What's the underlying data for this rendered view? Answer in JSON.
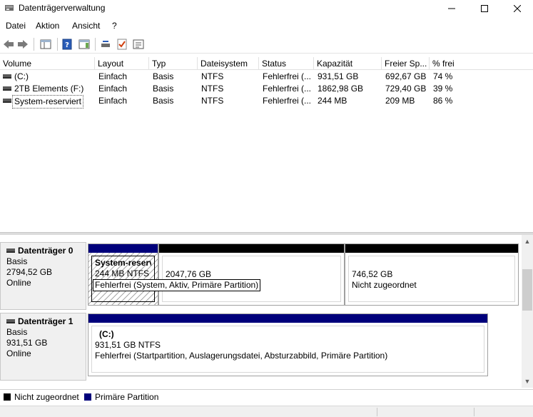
{
  "window": {
    "title": "Datenträgerverwaltung"
  },
  "menu": {
    "items": [
      "Datei",
      "Aktion",
      "Ansicht",
      "?"
    ]
  },
  "toolbar": {
    "icons": [
      "back-arrow-icon",
      "forward-arrow-icon",
      "console-tree-icon",
      "help-icon",
      "action-pane-icon",
      "connect-disk-icon",
      "check-icon",
      "properties-icon"
    ]
  },
  "volume_list": {
    "columns": [
      "Volume",
      "Layout",
      "Typ",
      "Dateisystem",
      "Status",
      "Kapazität",
      "Freier Sp...",
      "% frei"
    ],
    "rows": [
      {
        "volume": "(C:)",
        "layout": "Einfach",
        "typ": "Basis",
        "fs": "NTFS",
        "status": "Fehlerfrei (...",
        "capacity": "931,51 GB",
        "free": "692,67 GB",
        "percent": "74 %"
      },
      {
        "volume": "2TB Elements (F:)",
        "layout": "Einfach",
        "typ": "Basis",
        "fs": "NTFS",
        "status": "Fehlerfrei (...",
        "capacity": "1862,98 GB",
        "free": "729,40 GB",
        "percent": "39 %"
      },
      {
        "volume": "System-reserviert",
        "layout": "Einfach",
        "typ": "Basis",
        "fs": "NTFS",
        "status": "Fehlerfrei (...",
        "capacity": "244 MB",
        "free": "209 MB",
        "percent": "86 %"
      }
    ]
  },
  "disks": [
    {
      "name": "Datenträger 0",
      "type": "Basis",
      "size": "2794,52 GB",
      "state": "Online",
      "partitions": [
        {
          "title": "System-reserv",
          "size": "244 MB NTFS",
          "status": "Fehlerfrei (System, Aktiv, Primäre Partition)"
        },
        {
          "size": "2047,76 GB"
        },
        {
          "size": "746,52 GB",
          "status": "Nicht zugeordnet"
        }
      ]
    },
    {
      "name": "Datenträger 1",
      "type": "Basis",
      "size": "931,51 GB",
      "state": "Online",
      "partitions": [
        {
          "title": "(C:)",
          "size": "931,51 GB NTFS",
          "status": "Fehlerfrei (Startpartition, Auslagerungsdatei, Absturzabbild, Primäre Partition)"
        }
      ]
    }
  ],
  "legend": [
    {
      "label": "Nicht zugeordnet",
      "color": "#000000"
    },
    {
      "label": "Primäre Partition",
      "color": "#00007b"
    }
  ],
  "colors": {
    "primary": "#00007b",
    "unallocated": "#000000"
  }
}
